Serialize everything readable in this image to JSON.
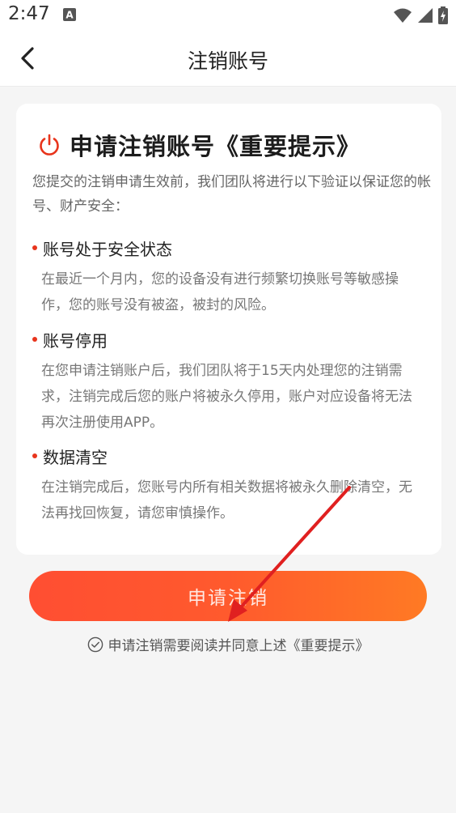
{
  "status_bar": {
    "time": "2:47"
  },
  "header": {
    "title": "注销账号"
  },
  "card": {
    "title": "申请注销账号《重要提示》",
    "intro": "您提交的注销申请生效前，我们团队将进行以下验证以保证您的帐号、财产安全：",
    "sections": [
      {
        "heading": "账号处于安全状态",
        "body": "在最近一个月内，您的设备没有进行频繁切换账号等敏感操作，您的账号没有被盗，被封的风险。"
      },
      {
        "heading": "账号停用",
        "body": "在您申请注销账户后，我们团队将于15天内处理您的注销需求，注销完成后您的账户将被永久停用，账户对应设备将无法再次注册使用APP。"
      },
      {
        "heading": "数据清空",
        "body": "在注销完成后，您账号内所有相关数据将被永久删除清空，无法再找回恢复，请您审慎操作。"
      }
    ]
  },
  "actions": {
    "apply_label": "申请注销",
    "agreement_text": "申请注销需要阅读并同意上述《重要提示》"
  },
  "colors": {
    "accent": "#e8341c",
    "button_start": "#ff4e32",
    "button_end": "#ff7a24",
    "background": "#f5f5f5"
  }
}
